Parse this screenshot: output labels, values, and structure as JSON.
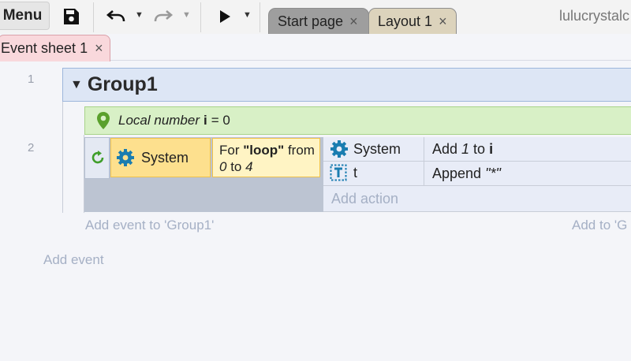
{
  "toolbar": {
    "menu_label": "Menu",
    "tabs": [
      {
        "label": "Start page",
        "close": "×"
      },
      {
        "label": "Layout 1",
        "close": "×"
      }
    ],
    "user_name": "lulucrystalc"
  },
  "subtabs": [
    {
      "label": "Event sheet 1",
      "close": "×"
    }
  ],
  "event_sheet": {
    "row_numbers": [
      "1",
      "2"
    ],
    "group": {
      "name": "Group1"
    },
    "local_variable": {
      "prefix": "Local number",
      "name": "i",
      "suffix": "= 0"
    },
    "event": {
      "condition": {
        "object": "System",
        "text_pre": "For ",
        "text_bold": "\"loop\"",
        "text_mid": " from",
        "from": "0",
        "to_word": " to ",
        "to": "4"
      },
      "actions": [
        {
          "object": "System",
          "pre": "Add ",
          "italic": "1",
          "mid": " to ",
          "bold": "i"
        },
        {
          "object": "t",
          "pre": "Append ",
          "italic": "\"*\""
        }
      ],
      "add_action": "Add action"
    },
    "add_event_to_group": "Add event to 'Group1'",
    "add_to_group": "Add to 'G",
    "add_event": "Add event"
  },
  "colors": {
    "group_bg": "#dde6f5",
    "local_var_bg": "#d8f0c6",
    "condition_bg": "#fde08e",
    "system_icon": "#1a7db0",
    "pin_icon": "#5aa02c",
    "active_tab": "#f9d8dc"
  },
  "icons": [
    "save-icon",
    "undo-icon",
    "redo-icon",
    "play-icon",
    "gear-icon",
    "pin-icon",
    "loop-icon",
    "text-object-icon"
  ]
}
